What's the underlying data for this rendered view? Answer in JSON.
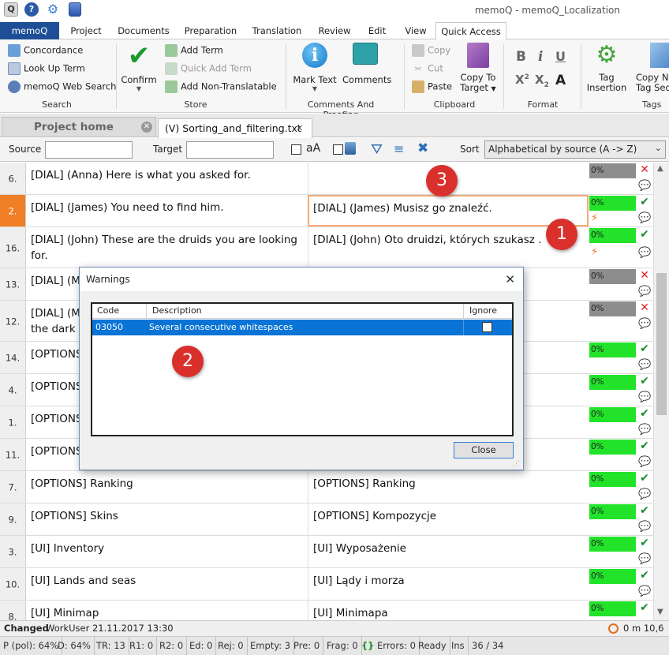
{
  "window": {
    "title": "memoQ - memoQ_Localization"
  },
  "ribbon_tabs": [
    "memoQ",
    "Project",
    "Documents",
    "Preparation",
    "Translation",
    "Review",
    "Edit",
    "View",
    "Quick Access"
  ],
  "active_tab": "Quick Access",
  "ribbon": {
    "search": {
      "items": [
        "Concordance",
        "Look Up Term",
        "memoQ Web Search"
      ],
      "label": "Search"
    },
    "store": {
      "confirm": "Confirm",
      "items": [
        "Add Term",
        "Quick Add Term",
        "Add Non-Translatable"
      ],
      "label": "Store"
    },
    "comments": {
      "mark_text": "Mark Text",
      "comments": "Comments",
      "label": "Comments And Proofing"
    },
    "clipboard": {
      "items": [
        "Copy",
        "Cut",
        "Paste"
      ],
      "copy_to_target": "Copy To",
      "copy_to_target2": "Target",
      "label": "Clipboard"
    },
    "format": {
      "bold": "B",
      "italic": "i",
      "underline": "U",
      "sup": "X",
      "sup_exp": "2",
      "sub": "X",
      "sub_exp": "2",
      "label": "Format"
    },
    "tags": {
      "tag_insertion1": "Tag",
      "tag_insertion2": "Insertion",
      "copy_tag1": "Copy N",
      "copy_tag2": "Tag Sequ",
      "label": "Tags"
    }
  },
  "doc_tabs": {
    "project_home": "Project home",
    "document": "(V) Sorting_and_filtering.txt"
  },
  "filter": {
    "source_label": "Source",
    "source_value": "",
    "target_label": "Target",
    "target_value": "",
    "case_label": "aA",
    "sort_label": "Sort",
    "sort_value": "Alphabetical by source (A -> Z)"
  },
  "rows": [
    {
      "num": "6.",
      "source": "[DIAL] (Anna) Here is what you asked for.",
      "target": "",
      "pct": "0%",
      "status": "x"
    },
    {
      "num": "2.",
      "source": "[DIAL] (James) You need to find him.",
      "target": "[DIAL] (James) Musisz go  znaleźć.",
      "pct": "0%",
      "status": "check"
    },
    {
      "num": "16.",
      "source": "[DIAL] (John) These are the druids you are looking for.",
      "target": "[DIAL] (John) Oto druidzi, których szukasz .",
      "pct": "0%",
      "status": "check"
    },
    {
      "num": "13.",
      "source": "[DIAL] (M",
      "target": "",
      "pct": "0%",
      "status": "x"
    },
    {
      "num": "12.",
      "source": "[DIAL] (M",
      "source2": "the dark f",
      "target": "",
      "pct": "0%",
      "status": "x"
    },
    {
      "num": "14.",
      "source": "[OPTIONS",
      "target": "",
      "pct": "0%",
      "status": "check"
    },
    {
      "num": "4.",
      "source": "[OPTIONS",
      "target": "",
      "pct": "0%",
      "status": "check"
    },
    {
      "num": "1.",
      "source": "[OPTIONS",
      "target": "",
      "pct": "0%",
      "status": "check"
    },
    {
      "num": "11.",
      "source": "[OPTIONS",
      "target": "",
      "pct": "0%",
      "status": "check"
    },
    {
      "num": "7.",
      "source": "[OPTIONS] Ranking",
      "target": "[OPTIONS] Ranking",
      "pct": "0%",
      "status": "check"
    },
    {
      "num": "9.",
      "source": "[OPTIONS] Skins",
      "target": "[OPTIONS] Kompozycje",
      "pct": "0%",
      "status": "check"
    },
    {
      "num": "3.",
      "source": "[UI] Inventory",
      "target": "[UI] Wyposażenie",
      "pct": "0%",
      "status": "check"
    },
    {
      "num": "10.",
      "source": "[UI] Lands and seas",
      "target": "[UI] Lądy i morza",
      "pct": "0%",
      "status": "check"
    },
    {
      "num": "8.",
      "source": "[UI] Minimap",
      "target": "[UI] Minimapa",
      "pct": "0%",
      "status": "check"
    }
  ],
  "status_info": {
    "state": "Changed",
    "user": "WorkUser 21.11.2017 13:30",
    "timer": "0 m 10,6 s"
  },
  "statusbar": [
    "P (pol): 64%",
    "D: 64%",
    "TR: 13",
    "R1: 0",
    "R2: 0",
    "Ed: 0",
    "Rej: 0",
    "Empty: 3",
    "Pre: 0",
    "Frag: 0",
    "Errors: 0",
    "Ready",
    "Ins",
    "36 / 34"
  ],
  "dialog": {
    "title": "Warnings",
    "columns": {
      "code": "Code",
      "description": "Description",
      "ignore": "Ignore"
    },
    "rows": [
      {
        "code": "03050",
        "description": "Several consecutive whitespaces",
        "ignore": false
      }
    ],
    "close_button": "Close"
  },
  "callouts": [
    "1",
    "2",
    "3"
  ],
  "colors": {
    "accent": "#1e4f96",
    "selected_row": "#f07e26",
    "match_green": "#22e32a",
    "match_gray": "#909090",
    "error_red": "#e02020",
    "ok_green": "#1a8a2a",
    "list_selection": "#0a74d6"
  }
}
